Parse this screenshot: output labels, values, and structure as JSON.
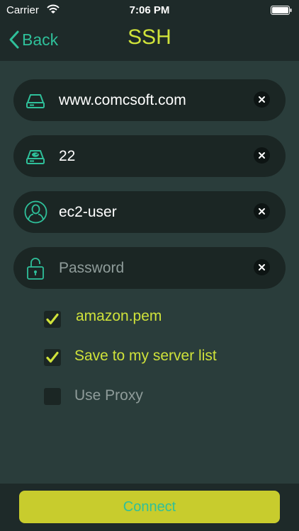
{
  "status_bar": {
    "carrier": "Carrier",
    "time": "7:06 PM"
  },
  "nav": {
    "back_label": "Back",
    "title": "SSH"
  },
  "form": {
    "host": {
      "value": "www.comcsoft.com",
      "icon": "drive-icon"
    },
    "port": {
      "value": "22",
      "icon": "port-drive-icon"
    },
    "username": {
      "value": "ec2-user",
      "icon": "user-icon"
    },
    "password": {
      "value": "",
      "placeholder": "Password",
      "icon": "unlock-icon"
    }
  },
  "options": [
    {
      "label": "amazon.pem",
      "checked": true
    },
    {
      "label": "Save to my server list",
      "checked": true
    },
    {
      "label": "Use Proxy",
      "checked": false
    }
  ],
  "connect_label": "Connect",
  "colors": {
    "background": "#2a3d3b",
    "bar": "#1e2a29",
    "field": "#1b2624",
    "accent_green": "#2fc09a",
    "accent_yellow": "#cfe23a",
    "button": "#c8cc2d",
    "muted": "#8f9c9a"
  }
}
